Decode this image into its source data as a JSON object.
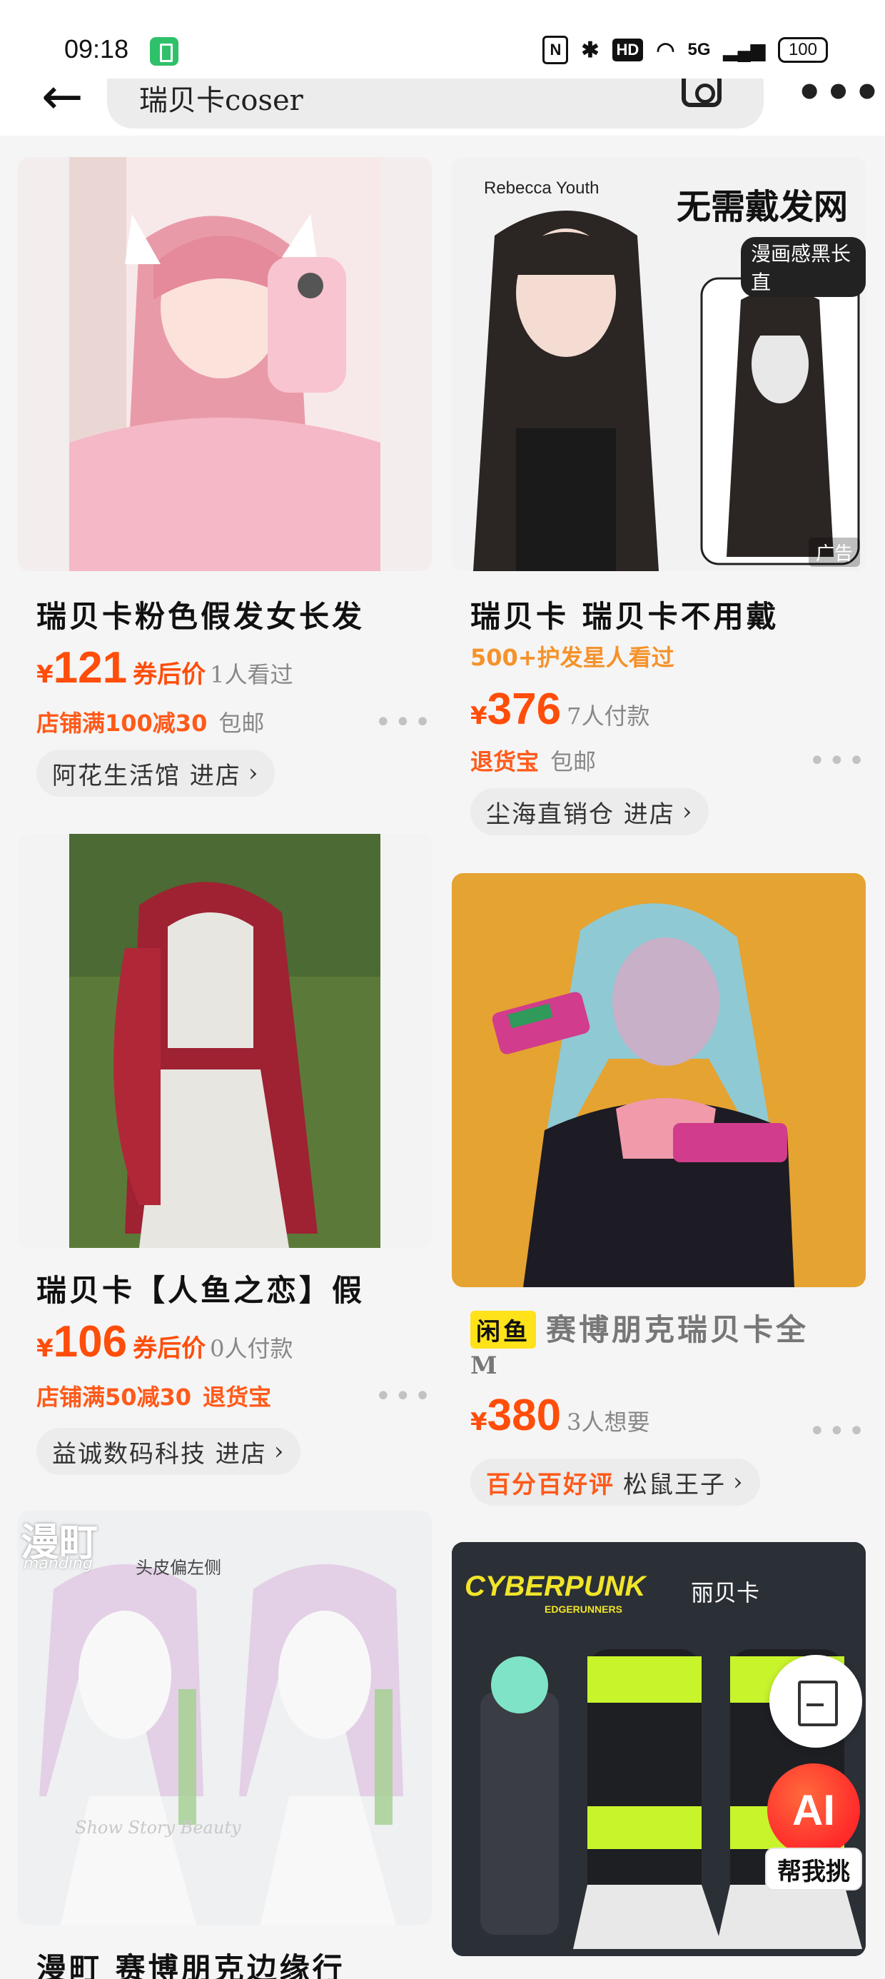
{
  "status_bar": {
    "time": "09:18",
    "nfc": "N",
    "bluetooth": "✱",
    "hd": "HD",
    "wifi": "◠",
    "network": "5G",
    "signal": "▂▄▆",
    "battery": "100"
  },
  "search": {
    "query": "瑞贝卡coser"
  },
  "products": [
    {
      "title": "瑞贝卡粉色假发女长发",
      "price": "121",
      "coupon": "券后价",
      "meta": "1人看过",
      "promo": "店铺满100减30",
      "shipping": "包邮",
      "shop": "阿花生活馆 进店"
    },
    {
      "title": "瑞贝卡 瑞贝卡不用戴",
      "hot": "500+护发星人看过",
      "price": "376",
      "meta": "7人付款",
      "promo": "退货宝",
      "shipping": "包邮",
      "shop": "尘海直销仓 进店",
      "ad": "广告",
      "image_text": {
        "brand": "Rebecca Youth",
        "headline": "无需戴发网",
        "sub": "漫画感黑长直"
      }
    },
    {
      "title": "瑞贝卡【人鱼之恋】假",
      "price": "106",
      "coupon": "券后价",
      "meta": "0人付款",
      "promo": "店铺满50减30",
      "promo2": "退货宝",
      "shop": "益诚数码科技 进店"
    },
    {
      "badge": "闲鱼",
      "title": "赛博朋克瑞贝卡全",
      "title_line2": "M",
      "price": "380",
      "meta": "3人想要",
      "shop_highlight": "百分百好评",
      "shop": "松鼠王子"
    },
    {
      "title": "漫町 赛博朋克边缘行",
      "image_text": {
        "logo": "漫町",
        "logo_sub": "manding",
        "note": "头皮偏左侧",
        "watermark": "Show Story Beauty"
      }
    },
    {
      "image_text": {
        "logo": "CYBERPUNK",
        "logo_sub": "EDGERUNNERS",
        "name": "丽贝卡"
      }
    }
  ],
  "fab": {
    "ai_label": "AI",
    "ai_caption": "帮我挑"
  }
}
